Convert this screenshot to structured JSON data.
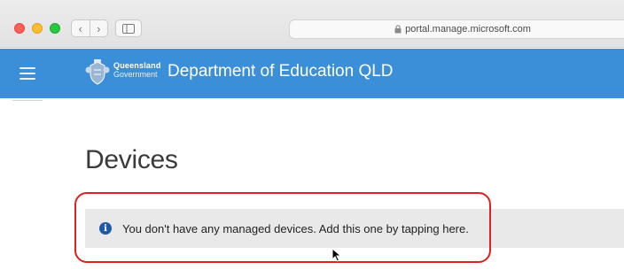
{
  "browser": {
    "url": "portal.manage.microsoft.com",
    "nav_back": "‹",
    "nav_forward": "›"
  },
  "header": {
    "logo_line1": "Queensland",
    "logo_line2": "Government",
    "org_title": "Department of Education QLD",
    "bg_color": "#3b8fd9"
  },
  "main": {
    "page_title": "Devices",
    "banner": {
      "icon": "info-icon",
      "message": "You don't have any managed devices. Add this one by tapping here."
    }
  },
  "annotation": {
    "highlight_color": "#e02020"
  }
}
